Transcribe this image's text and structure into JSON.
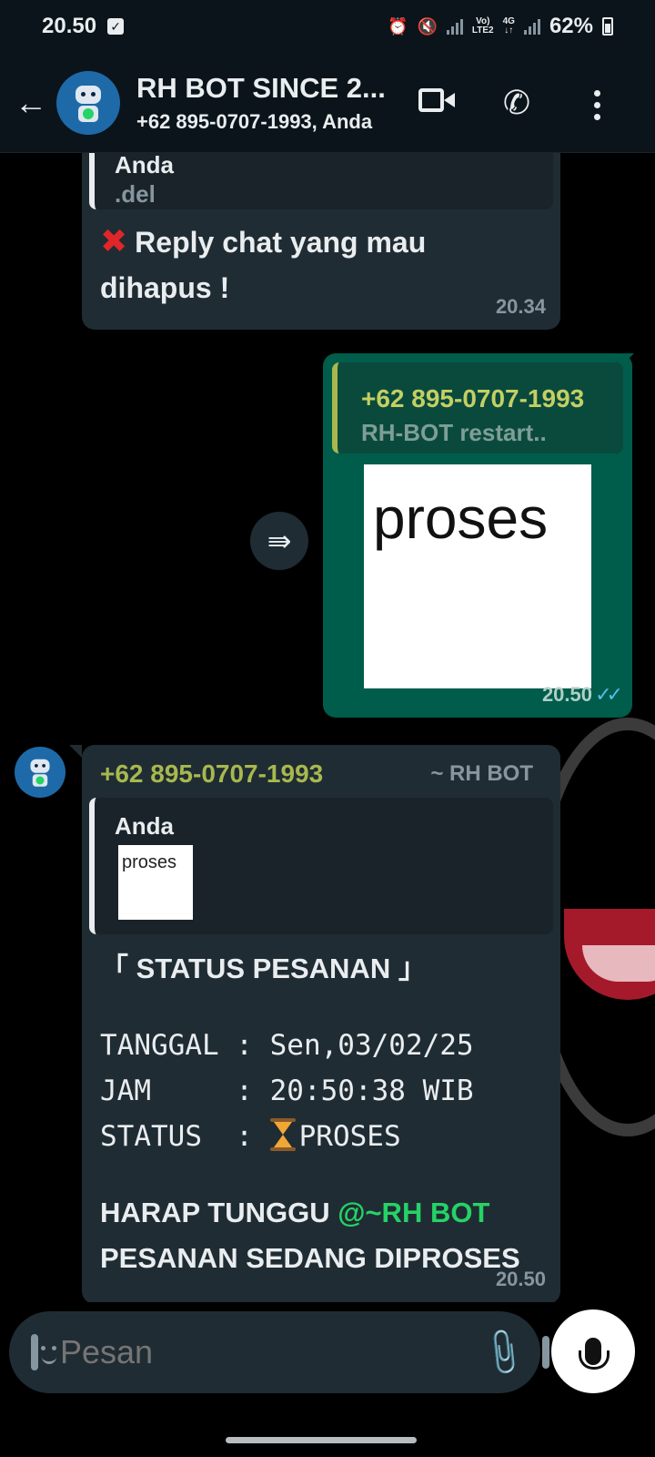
{
  "status_bar": {
    "time": "20.50",
    "network_label_1": "Vo)",
    "network_label_2": "LTE2",
    "network_label_3": "4G",
    "battery": "62%"
  },
  "header": {
    "title": "RH BOT SINCE 2...",
    "subtitle": "+62 895-0707-1993, Anda"
  },
  "messages": [
    {
      "direction": "in",
      "quote_name": "Anda",
      "quote_text": ".del",
      "text": "Reply chat yang mau dihapus !",
      "icon": "cross-mark",
      "time": "20.34"
    },
    {
      "direction": "out",
      "quote_name": "+62 895-0707-1993",
      "quote_text": "RH-BOT restart..",
      "image_text": "proses",
      "time": "20.50",
      "ticks": "read"
    },
    {
      "direction": "in",
      "sender": "+62 895-0707-1993",
      "sender_alias": "~ RH BOT",
      "quote_name": "Anda",
      "quote_image_text": "proses",
      "title": "「 STATUS PESANAN 」",
      "rows": [
        "TANGGAL : Sen,03/02/25",
        "JAM     : 20:50:38 WIB",
        "STATUS  : "
      ],
      "status_value": "PROSES",
      "foot_1_prefix": "HARAP TUNGGU ",
      "foot_1_mention": "@~RH BOT",
      "foot_2": "PESANAN SEDANG DIPROSES",
      "time": "20.50"
    }
  ],
  "input": {
    "placeholder": "Pesan"
  },
  "colors": {
    "accent_green": "#25d366",
    "outgoing_bubble": "#005c4b",
    "incoming_bubble": "#202c33",
    "read_ticks": "#53bdeb"
  }
}
